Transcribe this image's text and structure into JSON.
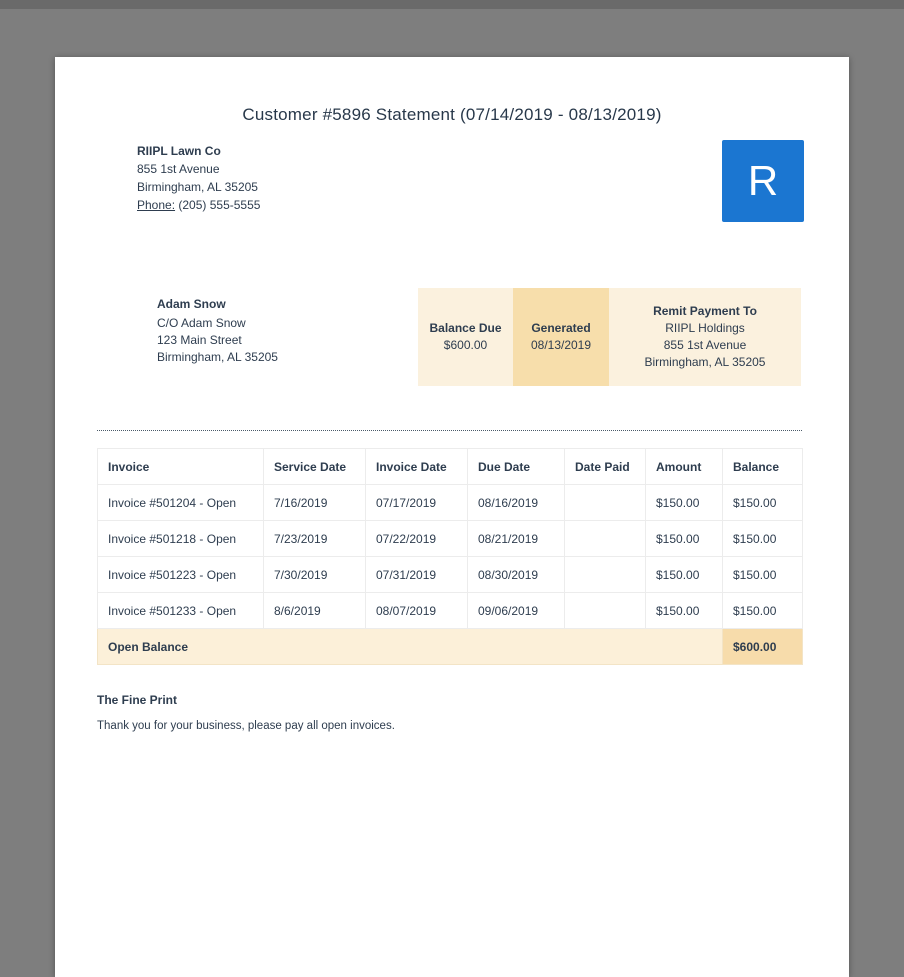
{
  "doc": {
    "title": "Customer #5896 Statement (07/14/2019 - 08/13/2019)"
  },
  "company": {
    "name": "RIIPL Lawn Co",
    "address1": "855 1st Avenue",
    "address2": "Birmingham, AL 35205",
    "phone_label": "Phone:",
    "phone": "(205) 555-5555"
  },
  "logo": {
    "letter": "R"
  },
  "customer": {
    "name": "Adam Snow",
    "line1": "C/O Adam Snow",
    "line2": "123 Main Street",
    "line3": "Birmingham, AL 35205"
  },
  "summary": {
    "balance_due_label": "Balance Due",
    "balance_due_value": "$600.00",
    "generated_label": "Generated",
    "generated_value": "08/13/2019",
    "remit_label": "Remit Payment To",
    "remit_name": "RIIPL Holdings",
    "remit_address1": "855 1st Avenue",
    "remit_address2": "Birmingham, AL 35205"
  },
  "table": {
    "headers": [
      "Invoice",
      "Service Date",
      "Invoice Date",
      "Due Date",
      "Date Paid",
      "Amount",
      "Balance"
    ],
    "rows": [
      [
        "Invoice #501204 - Open",
        "7/16/2019",
        "07/17/2019",
        "08/16/2019",
        "",
        "$150.00",
        "$150.00"
      ],
      [
        "Invoice #501218 - Open",
        "7/23/2019",
        "07/22/2019",
        "08/21/2019",
        "",
        "$150.00",
        "$150.00"
      ],
      [
        "Invoice #501223 - Open",
        "7/30/2019",
        "07/31/2019",
        "08/30/2019",
        "",
        "$150.00",
        "$150.00"
      ],
      [
        "Invoice #501233 - Open",
        "8/6/2019",
        "08/07/2019",
        "09/06/2019",
        "",
        "$150.00",
        "$150.00"
      ]
    ],
    "footer_label": "Open Balance",
    "footer_value": "$600.00"
  },
  "fine_print": {
    "title": "The Fine Print",
    "body": "Thank you for your business, please pay all open invoices."
  },
  "colors": {
    "accent_blue": "#1b76d1",
    "cream_light": "#fbf1de",
    "cream_dark": "#f7deab",
    "text_dark": "#2e3d4f",
    "viewer_background": "#7e7e7e"
  }
}
